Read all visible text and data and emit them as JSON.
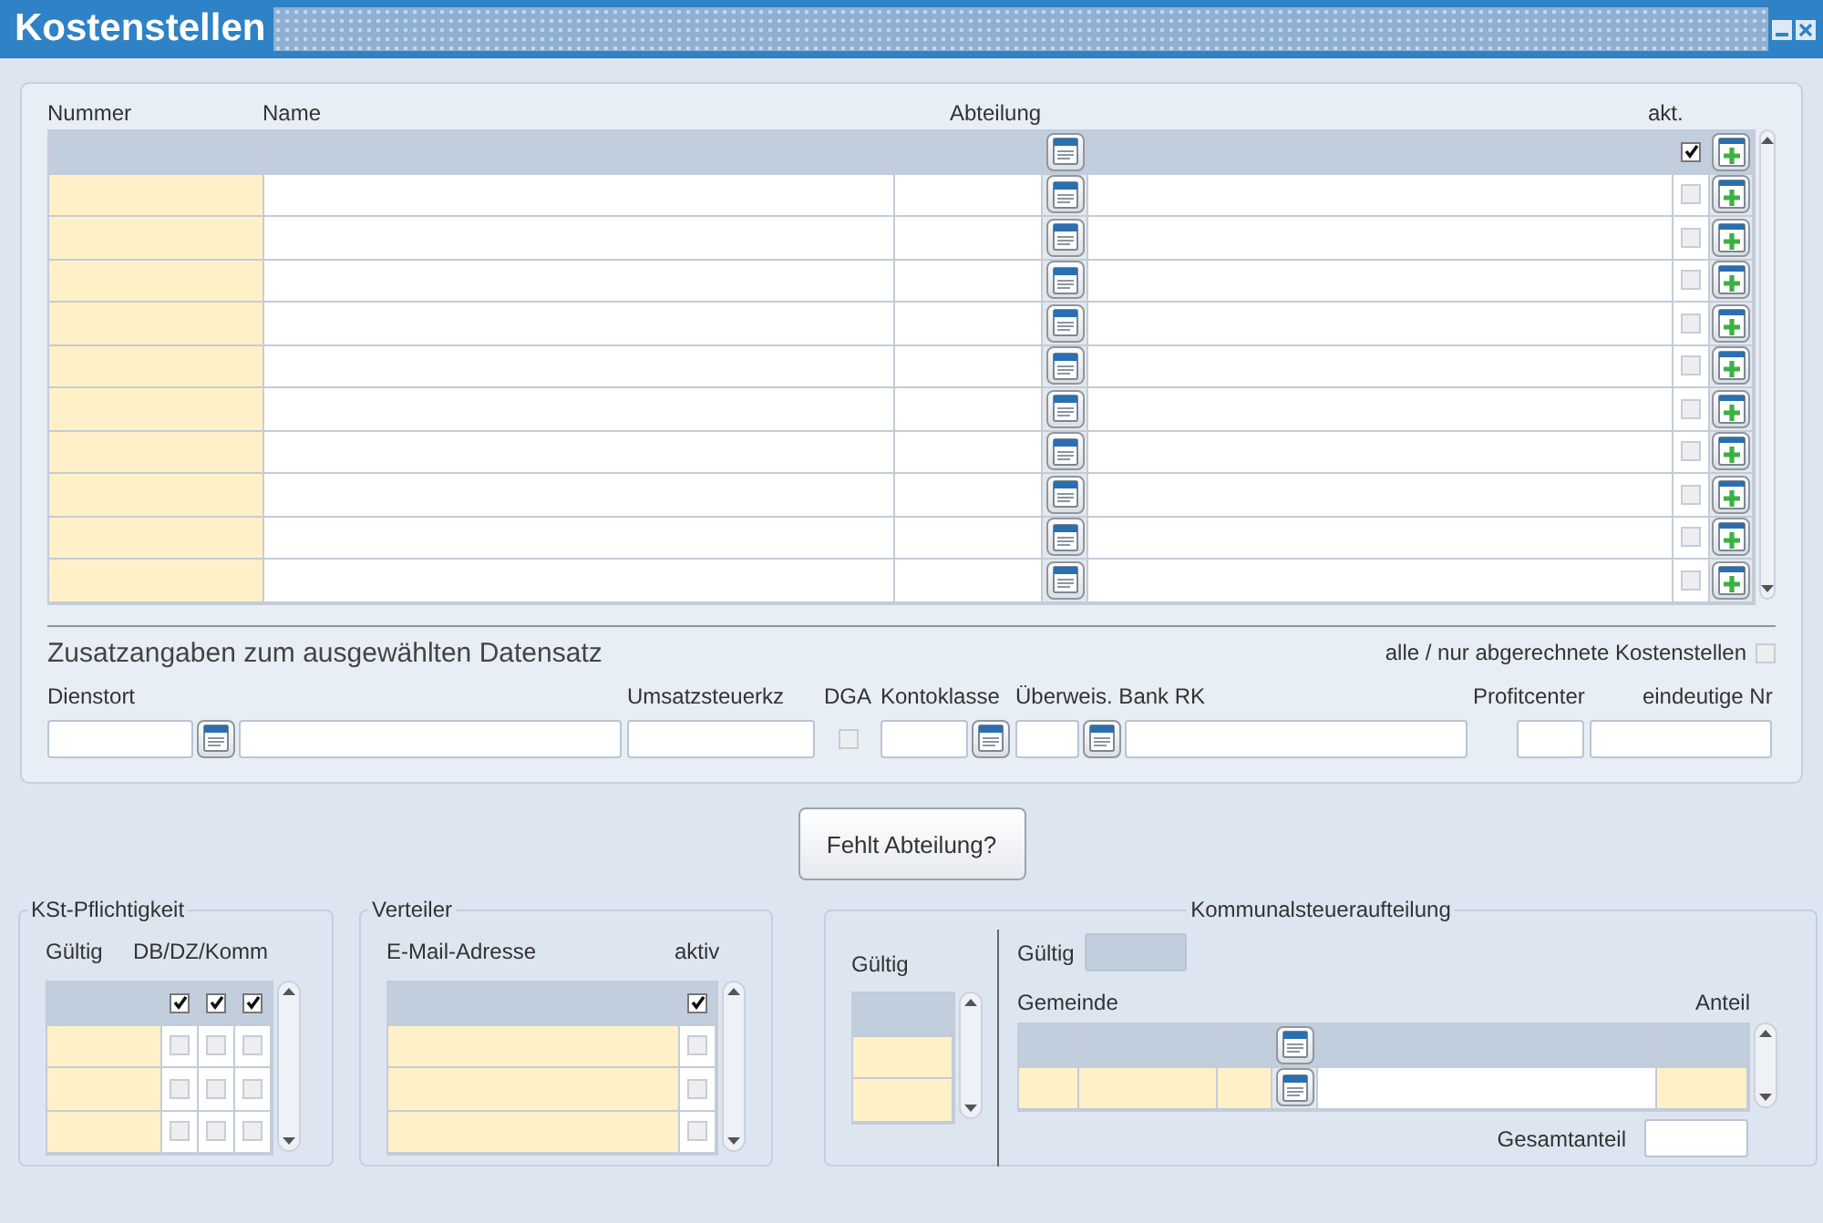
{
  "window": {
    "title": "Kostenstellen"
  },
  "main_table": {
    "columns": [
      "Nummer",
      "Name",
      "Abteilung",
      "akt."
    ],
    "rows": [
      {
        "selected": true,
        "checked": true
      },
      {
        "selected": false,
        "checked": false
      },
      {
        "selected": false,
        "checked": false
      },
      {
        "selected": false,
        "checked": false
      },
      {
        "selected": false,
        "checked": false
      },
      {
        "selected": false,
        "checked": false
      },
      {
        "selected": false,
        "checked": false
      },
      {
        "selected": false,
        "checked": false
      },
      {
        "selected": false,
        "checked": false
      },
      {
        "selected": false,
        "checked": false
      },
      {
        "selected": false,
        "checked": false
      }
    ]
  },
  "details": {
    "title": "Zusatzangaben zum ausgewählten Datensatz",
    "filter_label": "alle / nur abgerechnete Kostenstellen",
    "filter_checked": false,
    "labels": {
      "dienstort": "Dienstort",
      "umsatz": "Umsatzsteuerkz",
      "dga": "DGA",
      "kontoklasse": "Kontoklasse",
      "bank": "Überweis. Bank RK",
      "profitcenter": "Profitcenter",
      "nr": "eindeutige Nr"
    },
    "dga_checked": false
  },
  "missing_button": "Fehlt Abteilung?",
  "kst": {
    "title": "KSt-Pflichtigkeit",
    "columns": [
      "Gültig",
      "DB/DZ/Komm"
    ],
    "rows": [
      {
        "selected": true,
        "checks": [
          true,
          true,
          true
        ]
      },
      {
        "selected": false,
        "checks": [
          false,
          false,
          false
        ]
      },
      {
        "selected": false,
        "checks": [
          false,
          false,
          false
        ]
      },
      {
        "selected": false,
        "checks": [
          false,
          false,
          false
        ]
      }
    ]
  },
  "verteiler": {
    "title": "Verteiler",
    "columns": [
      "E-Mail-Adresse",
      "aktiv"
    ],
    "rows": [
      {
        "selected": true,
        "checked": true
      },
      {
        "selected": false,
        "checked": false
      },
      {
        "selected": false,
        "checked": false
      },
      {
        "selected": false,
        "checked": false
      }
    ]
  },
  "kommunal": {
    "title": "Kommunalsteueraufteilung",
    "valid_list": {
      "label": "Gültig",
      "rows": [
        {
          "selected": true
        },
        {
          "selected": false
        },
        {
          "selected": false
        }
      ]
    },
    "valid_field_label": "Gültig",
    "columns": [
      "Gemeinde",
      "Anteil"
    ],
    "rows": [
      {
        "selected": true
      },
      {
        "selected": false
      }
    ],
    "total_label": "Gesamtanteil"
  }
}
